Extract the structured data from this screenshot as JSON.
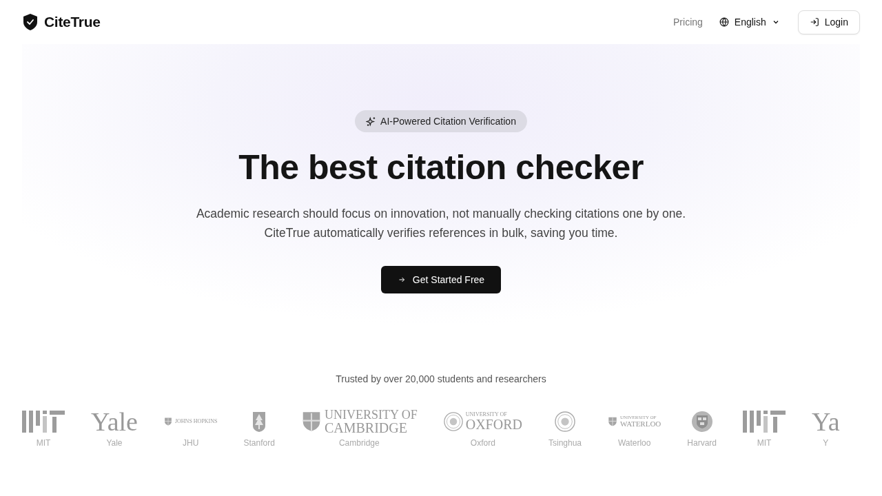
{
  "header": {
    "brand": "CiteTrue",
    "nav": [
      {
        "kind": "link",
        "label": "Pricing"
      },
      {
        "kind": "language",
        "label": "English"
      }
    ],
    "login": "Login"
  },
  "hero": {
    "badge": "AI-Powered Citation Verification",
    "title": "The best citation checker",
    "subtitle": [
      "Academic research should focus on innovation, not manually checking citations one by one.",
      "CiteTrue automatically verifies references in bulk, saving you time."
    ],
    "cta": "Get Started Free"
  },
  "trusted": {
    "caption": "Trusted by over 20,000 students and researchers",
    "logos": [
      {
        "kind": "bars",
        "caption": "MIT"
      },
      {
        "kind": "text",
        "wordmark": [
          "Yale"
        ],
        "caption": "Yale"
      },
      {
        "kind": "small-shield-text",
        "wordmark": [
          "JOHNS HOPKINS"
        ],
        "caption": "JHU"
      },
      {
        "kind": "tree-shield",
        "caption": "Stanford"
      },
      {
        "kind": "shield-text",
        "wordmark": [
          "UNIVERSITY OF",
          "CAMBRIDGE"
        ],
        "caption": "Cambridge"
      },
      {
        "kind": "seal-text",
        "wordmark": [
          "UNIVERSITY OF",
          "OXFORD"
        ],
        "caption": "Oxford"
      },
      {
        "kind": "seal",
        "caption": "Tsinghua"
      },
      {
        "kind": "small-shield-stack",
        "wordmark": [
          "UNIVERSITY OF",
          "WATERLOO"
        ],
        "caption": "Waterloo"
      },
      {
        "kind": "crest",
        "caption": "Harvard"
      },
      {
        "kind": "bars",
        "caption": "MIT"
      },
      {
        "kind": "text",
        "wordmark": [
          "Ya"
        ],
        "caption": "Y"
      }
    ]
  }
}
